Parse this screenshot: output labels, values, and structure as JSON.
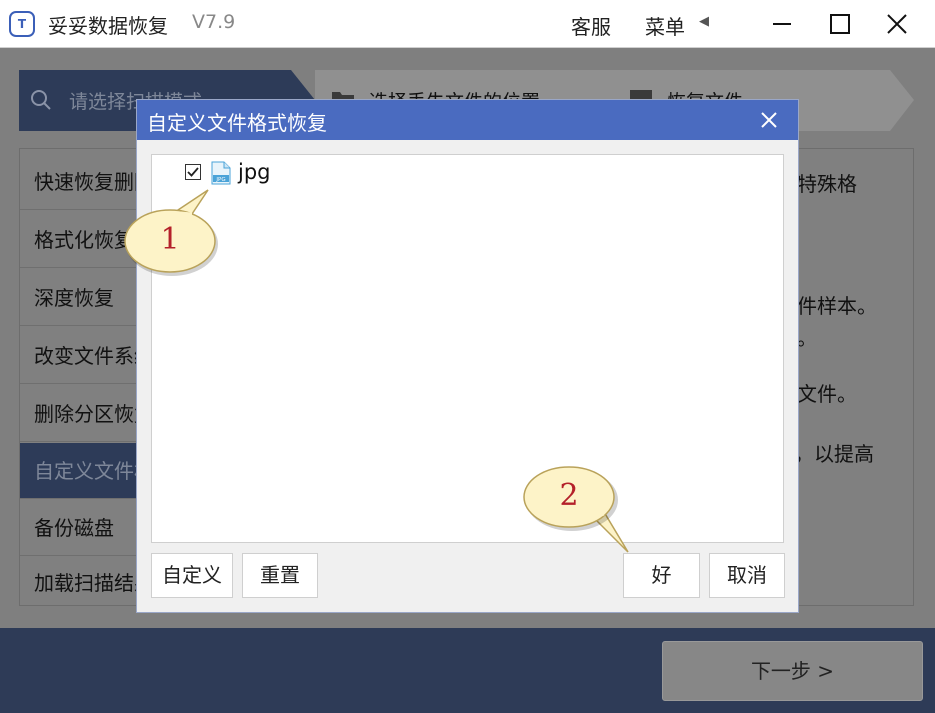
{
  "app": {
    "title": "妥妥数据恢复",
    "version": "V7.9",
    "service_label": "客服",
    "menu_label": "菜单"
  },
  "steps": [
    {
      "label": "请选择扫描模式"
    },
    {
      "label": "选择丢失文件的位置"
    },
    {
      "label": "恢复文件"
    }
  ],
  "modes": [
    {
      "label": "快速恢复删除的文件"
    },
    {
      "label": "格式化恢复"
    },
    {
      "label": "深度恢复"
    },
    {
      "label": "改变文件系统恢复"
    },
    {
      "label": "删除分区恢复"
    },
    {
      "label": "自定义文件格式恢复"
    },
    {
      "label": "备份磁盘"
    },
    {
      "label": "加载扫描结果"
    }
  ],
  "description_fragments": [
    "特殊格",
    "件样本。",
    "。",
    "文件。",
    "，以提高"
  ],
  "dialog": {
    "title": "自定义文件格式恢复",
    "formats": [
      {
        "label": "jpg",
        "checked": true,
        "icon_text": "JPG"
      }
    ],
    "custom_button": "自定义",
    "reset_button": "重置",
    "ok_button": "好",
    "cancel_button": "取消"
  },
  "callouts": [
    "1",
    "2"
  ],
  "next_button": "下一步 >",
  "colors": {
    "accent": "#4a6bc0",
    "dark": "#2e3b57",
    "callout_fill": "#fdf3c8",
    "callout_text": "#b4202a"
  }
}
